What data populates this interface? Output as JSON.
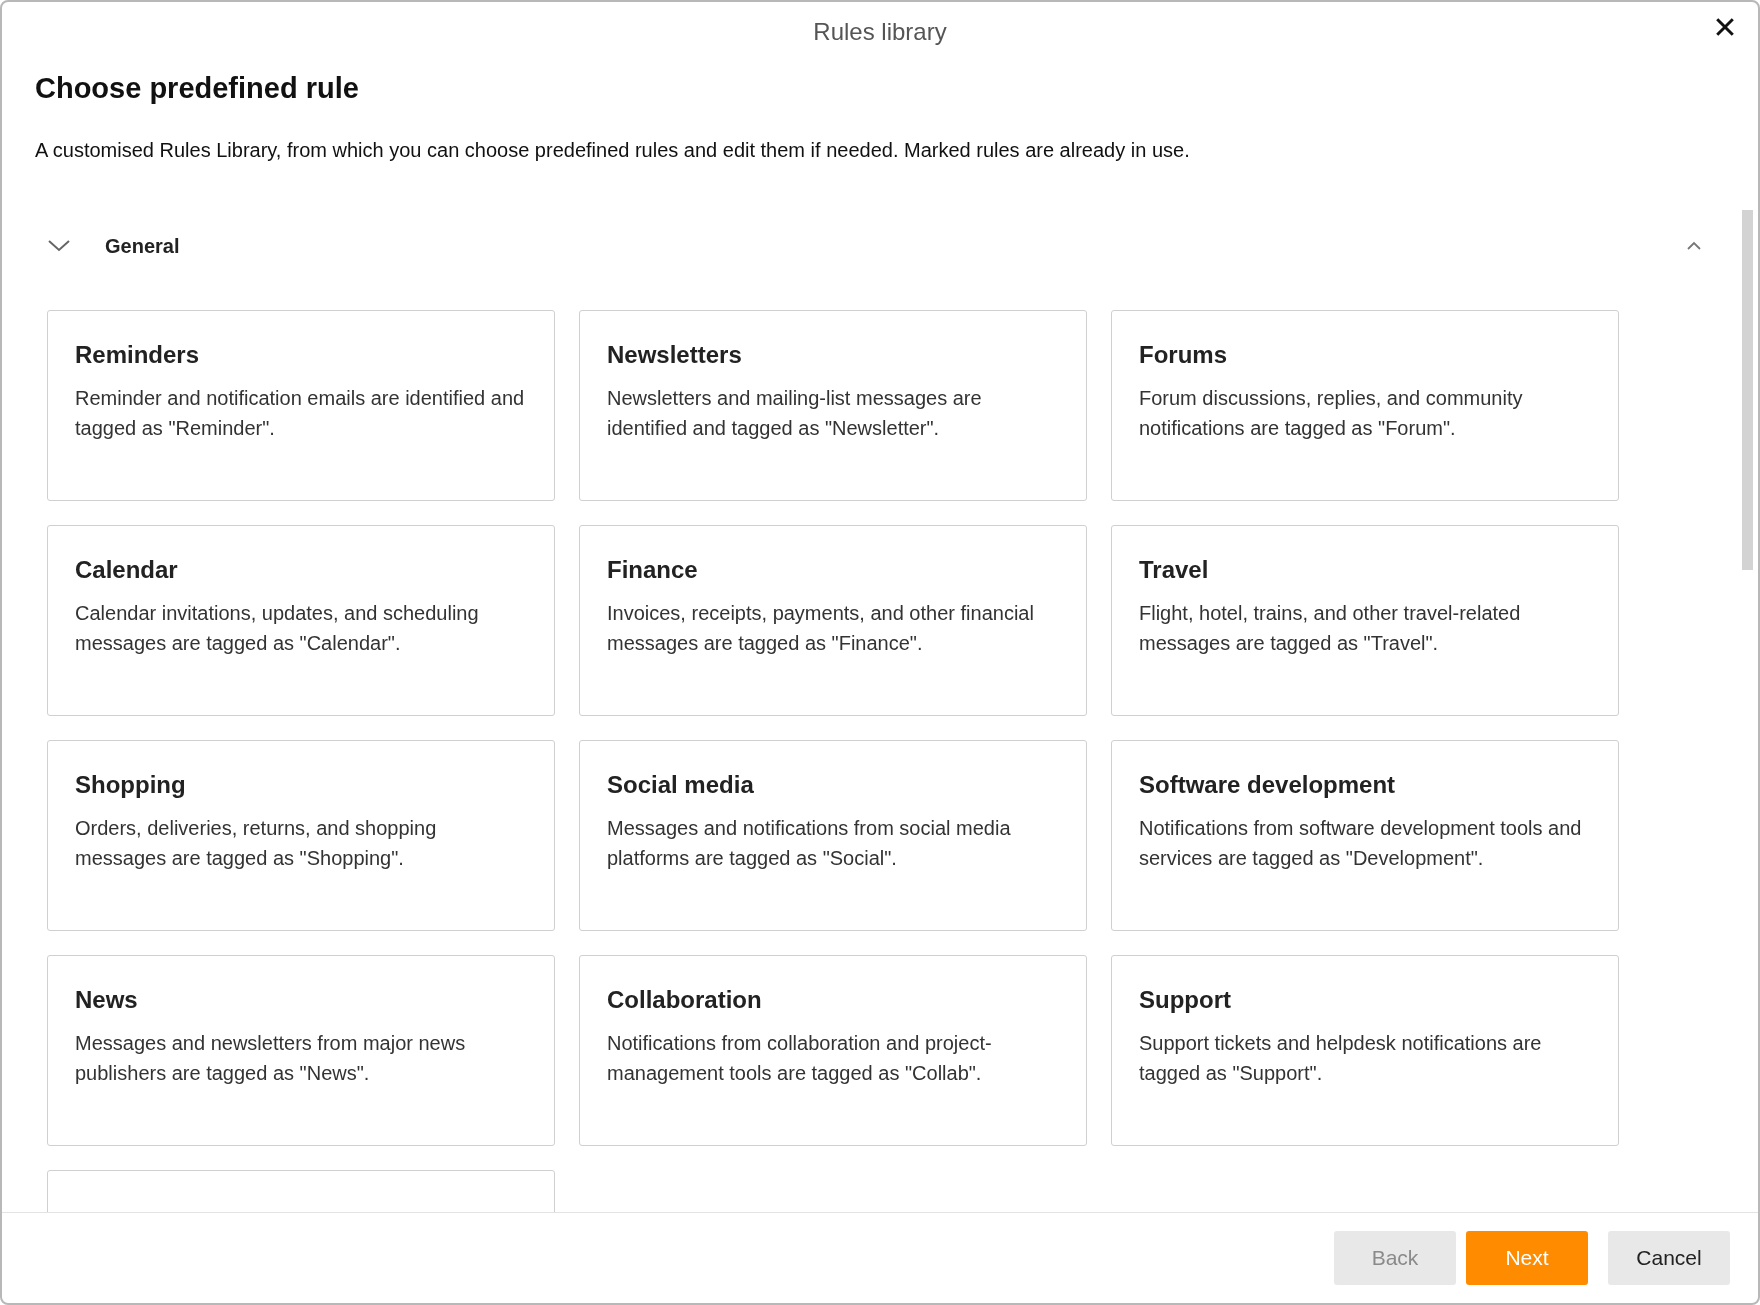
{
  "window": {
    "title": "Rules library"
  },
  "heading": "Choose predefined rule",
  "description": "A customised Rules Library, from which you can choose predefined rules and edit them if needed. Marked rules are already in use.",
  "section": {
    "label": "General",
    "expanded": true,
    "cards": [
      {
        "title": "Reminders",
        "text": "Reminder and notification emails are identified and tagged as \"Reminder\"."
      },
      {
        "title": "Newsletters",
        "text": "Newsletters and mailing-list messages are identified and tagged as \"Newsletter\"."
      },
      {
        "title": "Forums",
        "text": "Forum discussions, replies, and community notifications are tagged as \"Forum\"."
      },
      {
        "title": "Calendar",
        "text": "Calendar invitations, updates, and scheduling messages are tagged as \"Calendar\"."
      },
      {
        "title": "Finance",
        "text": "Invoices, receipts, payments, and other financial messages are tagged as \"Finance\"."
      },
      {
        "title": "Travel",
        "text": "Flight, hotel, trains, and other travel-related messages are tagged as \"Travel\"."
      },
      {
        "title": "Shopping",
        "text": "Orders, deliveries, returns, and shopping messages are tagged as \"Shopping\"."
      },
      {
        "title": "Social media",
        "text": "Messages and notifications from social media platforms are tagged as \"Social\"."
      },
      {
        "title": "Software development",
        "text": "Notifications from software development tools and services are tagged as \"Development\"."
      },
      {
        "title": "News",
        "text": "Messages and newsletters from major news publishers are tagged as \"News\"."
      },
      {
        "title": "Collaboration",
        "text": "Notifications from collaboration and project-management tools are tagged as \"Collab\"."
      },
      {
        "title": "Support",
        "text": "Support tickets and helpdesk notifications are tagged as \"Support\"."
      }
    ]
  },
  "buttons": [
    {
      "label": "Back",
      "kind": "secondary",
      "disabled": true
    },
    {
      "label": "Next",
      "kind": "primary",
      "disabled": false
    },
    {
      "label": "Cancel",
      "kind": "secondary",
      "disabled": false
    }
  ]
}
